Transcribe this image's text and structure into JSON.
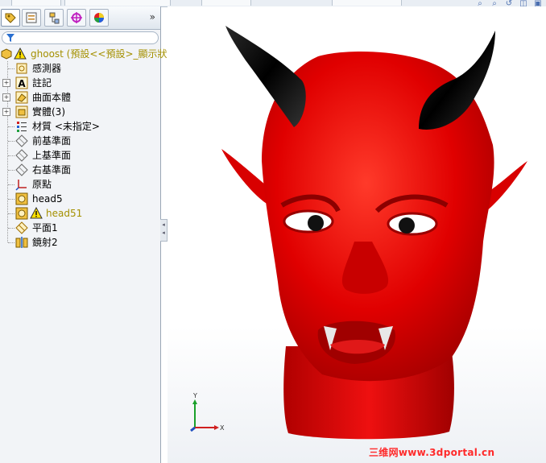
{
  "tree": {
    "root": "ghoost (預設<<預設>_顯示狀",
    "items": [
      {
        "label": "感測器",
        "icon": "sensor-icon",
        "expandable": false
      },
      {
        "label": "註記",
        "icon": "annotation-icon",
        "expandable": true
      },
      {
        "label": "曲面本體",
        "icon": "surface-body-icon",
        "expandable": true
      },
      {
        "label": "實體(3)",
        "icon": "solid-body-icon",
        "expandable": true
      },
      {
        "label": "材質 <未指定>",
        "icon": "material-icon",
        "expandable": false
      },
      {
        "label": "前基準面",
        "icon": "plane-icon",
        "expandable": false
      },
      {
        "label": "上基準面",
        "icon": "plane-icon",
        "expandable": false
      },
      {
        "label": "右基準面",
        "icon": "plane-icon",
        "expandable": false
      },
      {
        "label": "原點",
        "icon": "origin-icon",
        "expandable": false
      },
      {
        "label": "head5",
        "icon": "imported-part-icon",
        "expandable": false
      },
      {
        "label": "head51",
        "icon": "imported-part-icon",
        "expandable": false,
        "warning": true
      },
      {
        "label": "平面1",
        "icon": "plane1-icon",
        "expandable": false
      },
      {
        "label": "鏡射2",
        "icon": "mirror-icon",
        "expandable": false
      }
    ]
  },
  "tabs": [
    "feature-manager",
    "property-manager",
    "configuration-manager",
    "dimxpert-manager",
    "display-manager"
  ],
  "more_label": "»",
  "triad": {
    "x": "X",
    "y": "Y"
  },
  "watermark": "三维网www.3dportal.cn",
  "colors": {
    "model": "#e00000",
    "horns": "#111111",
    "panel": "#f2f4f7",
    "warning": "#a49000"
  }
}
